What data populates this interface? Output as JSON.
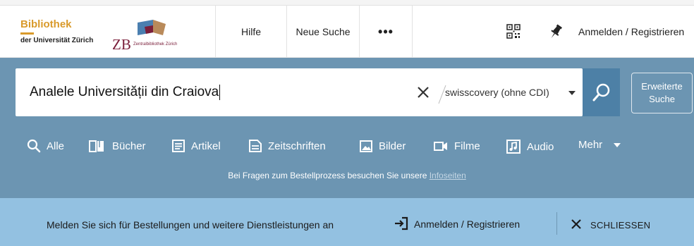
{
  "logo": {
    "uzh_line1": "Bibliothek",
    "uzh_line2": "der Universität Zürich",
    "zb_text": "ZB",
    "zb_sub": "Zentralbibliothek Zürich"
  },
  "header": {
    "help_label": "Hilfe",
    "new_search_label": "Neue Suche",
    "more_label": "•••",
    "login_label": "Anmelden / Registrieren"
  },
  "search": {
    "query": "Analele Universității din Craiova",
    "scope": "swisscovery (ohne CDI)",
    "advanced_line1": "Erweiterte",
    "advanced_line2": "Suche"
  },
  "categories": [
    {
      "label": "Alle",
      "icon": "search-icon"
    },
    {
      "label": "Bücher",
      "icon": "book-icon"
    },
    {
      "label": "Artikel",
      "icon": "article-icon"
    },
    {
      "label": "Zeitschriften",
      "icon": "journal-icon"
    },
    {
      "label": "Bilder",
      "icon": "image-icon"
    },
    {
      "label": "Filme",
      "icon": "video-icon"
    },
    {
      "label": "Audio",
      "icon": "audio-icon"
    },
    {
      "label": "Mehr",
      "icon": "chevron-down-icon"
    }
  ],
  "info": {
    "text": "Bei Fragen zum Bestellprozess besuchen Sie unsere",
    "link": "Infoseiten"
  },
  "banner": {
    "message": "Melden Sie sich für Bestellungen und weitere Dienstleistungen an",
    "login_label": "Anmelden / Registrieren",
    "close_label": "SCHLIESSEN"
  },
  "colors": {
    "brand_blue": "#6c95b2",
    "search_button": "#4d80a6",
    "banner": "#93c1e1",
    "uzh_gold": "#d99a2b",
    "zb_red": "#7a1e3a"
  }
}
